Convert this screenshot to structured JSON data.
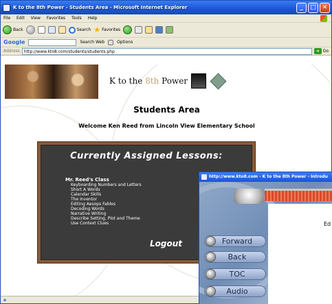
{
  "window": {
    "title": "K to the 8th Power - Students Area - Microsoft Internet Explorer"
  },
  "menu": [
    "File",
    "Edit",
    "View",
    "Favorites",
    "Tools",
    "Help"
  ],
  "toolbar": {
    "back_label": "Back",
    "search_label": "Search",
    "favorites_label": "Favorites"
  },
  "googlebar": {
    "logo": "Google",
    "search_web_label": "Search Web",
    "options_label": "Options"
  },
  "address": {
    "label": "Address",
    "url": "http://www.kto8.com/students/students.php",
    "go_label": "Go"
  },
  "page": {
    "logo_prefix": "K to the ",
    "logo_emph": "8th",
    "logo_suffix": " Power",
    "heading": "Students Area",
    "welcome": "Welcome Ken Reed from Lincoln View Elementary School",
    "board_title": "Currently Assigned Lessons:",
    "class_name": "Mr. Reed's Class",
    "lessons": [
      "Keyboarding Numbers and Letters",
      "Short A Words",
      "Calendar Skills",
      "The Inventor",
      "Editing Aesops Fables",
      "Decoding Words",
      "Narrative Writing",
      "Describe Setting, Plot and Theme",
      "Use Context Clues"
    ],
    "logout": "Logout"
  },
  "popup": {
    "title": "http://www.kto8.com - K to the 8th Power - Introdu",
    "partial_text": "Ed",
    "buttons": [
      "Forward",
      "Back",
      "TOC",
      "Audio"
    ]
  },
  "status": {
    "text": "e"
  }
}
